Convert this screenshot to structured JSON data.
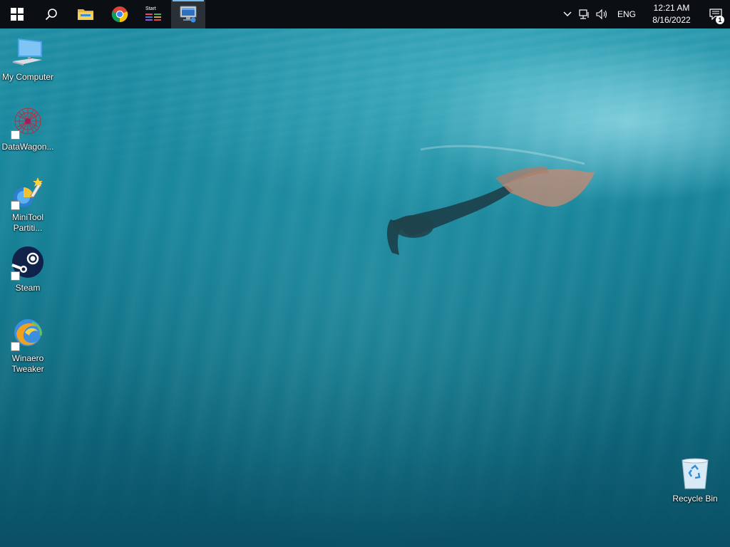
{
  "taskbar": {
    "pinned": [
      {
        "name": "start-button",
        "icon": "windows-logo-icon"
      },
      {
        "name": "search-button",
        "icon": "search-icon"
      },
      {
        "name": "file-explorer-button",
        "icon": "folder-icon"
      },
      {
        "name": "chrome-button",
        "icon": "chrome-icon"
      },
      {
        "name": "start-app-button",
        "icon": "start-app-icon",
        "label": "Start"
      },
      {
        "name": "remote-desktop-button",
        "icon": "computer-window-icon",
        "active": true
      }
    ],
    "tray": {
      "language": "ENG",
      "time": "12:21 AM",
      "date": "8/16/2022",
      "notification_count": "1"
    }
  },
  "desktop": {
    "icons": [
      {
        "label": "My Computer",
        "icon": "computer-icon",
        "shortcut": false
      },
      {
        "label": "DataWagon...",
        "icon": "datawagon-icon",
        "shortcut": true
      },
      {
        "label": "MiniTool Partiti...",
        "icon": "minitool-icon",
        "shortcut": true
      },
      {
        "label": "Steam",
        "icon": "steam-icon",
        "shortcut": true
      },
      {
        "label": "Winaero Tweaker",
        "icon": "winaero-icon",
        "shortcut": true
      },
      {
        "label": "Recycle Bin",
        "icon": "recycle-bin-icon",
        "shortcut": false
      }
    ]
  },
  "colors": {
    "taskbar_bg": "#0b0f14",
    "accent": "#76b9ed",
    "water": "#178399"
  }
}
